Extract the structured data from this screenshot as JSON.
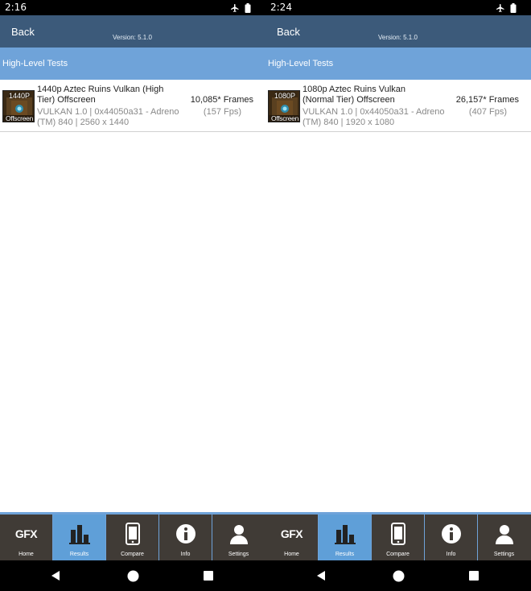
{
  "screens": [
    {
      "status": {
        "time": "2:16"
      },
      "appbar": {
        "back_label": "Back",
        "version": "Version: 5.1.0"
      },
      "section": {
        "label": "High-Level Tests"
      },
      "result": {
        "thumb_res": "1440P",
        "thumb_off": "Offscreen",
        "title": "1440p Aztec Ruins Vulkan (High Tier) Offscreen",
        "meta": "VULKAN 1.0 | 0x44050a31 - Adreno (TM) 840 | 2560 x 1440",
        "frames": "10,085* Frames",
        "fps": "(157 Fps)"
      },
      "tabs": [
        {
          "label": "Home",
          "icon": "gfx-logo",
          "text": "GFX"
        },
        {
          "label": "Results",
          "icon": "bar-chart-icon"
        },
        {
          "label": "Compare",
          "icon": "phone-icon"
        },
        {
          "label": "Info",
          "icon": "info-icon"
        },
        {
          "label": "Settings",
          "icon": "person-icon"
        }
      ]
    },
    {
      "status": {
        "time": "2:24"
      },
      "appbar": {
        "back_label": "Back",
        "version": "Version: 5.1.0"
      },
      "section": {
        "label": "High-Level Tests"
      },
      "result": {
        "thumb_res": "1080P",
        "thumb_off": "Offscreen",
        "title": "1080p Aztec Ruins Vulkan (Normal Tier) Offscreen",
        "meta": "VULKAN 1.0 | 0x44050a31 - Adreno (TM) 840 | 1920 x 1080",
        "frames": "26,157* Frames",
        "fps": "(407 Fps)"
      },
      "tabs": [
        {
          "label": "Home",
          "icon": "gfx-logo",
          "text": "GFX"
        },
        {
          "label": "Results",
          "icon": "bar-chart-icon"
        },
        {
          "label": "Compare",
          "icon": "phone-icon"
        },
        {
          "label": "Info",
          "icon": "info-icon"
        },
        {
          "label": "Settings",
          "icon": "person-icon"
        }
      ]
    }
  ],
  "active_tab": "Results",
  "colors": {
    "appbar": "#3c5a7a",
    "section": "#6fa3d9",
    "tab_bg": "#403b36",
    "tab_active": "#5f9fd8"
  }
}
